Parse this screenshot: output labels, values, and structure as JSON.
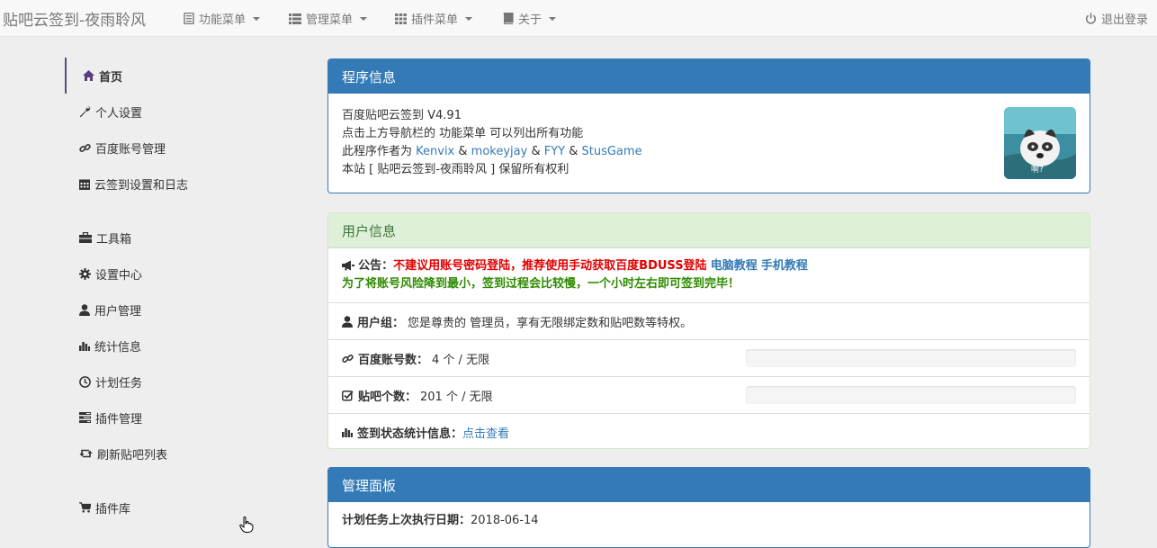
{
  "navbar": {
    "brand": "贴吧云签到-夜雨聆风",
    "menus": [
      {
        "label": "功能菜单",
        "icon": "list-icon"
      },
      {
        "label": "管理菜单",
        "icon": "th-list-icon"
      },
      {
        "label": "插件菜单",
        "icon": "th-icon"
      },
      {
        "label": "关于",
        "icon": "book-icon"
      }
    ],
    "logout": "退出登录"
  },
  "sidebar": {
    "items": [
      {
        "label": "首页",
        "icon": "home-icon",
        "active": true
      },
      {
        "label": "个人设置",
        "icon": "wrench-icon"
      },
      {
        "label": "百度账号管理",
        "icon": "link-icon"
      },
      {
        "label": "云签到设置和日志",
        "icon": "calendar-icon"
      },
      {
        "label": "工具箱",
        "icon": "briefcase-icon"
      },
      {
        "label": "设置中心",
        "icon": "cog-icon"
      },
      {
        "label": "用户管理",
        "icon": "user-icon"
      },
      {
        "label": "统计信息",
        "icon": "stats-icon"
      },
      {
        "label": "计划任务",
        "icon": "clock-icon"
      },
      {
        "label": "插件管理",
        "icon": "tasks-icon"
      },
      {
        "label": "刷新贴吧列表",
        "icon": "refresh-icon"
      },
      {
        "label": "插件库",
        "icon": "cart-icon"
      }
    ]
  },
  "program_info": {
    "title": "程序信息",
    "line1": "百度贴吧云签到 V4.91",
    "line2": "点击上方导航栏的 功能菜单 可以列出所有功能",
    "line3_prefix": "此程序作者为 ",
    "authors": [
      "Kenvix",
      "mokeyjay",
      "FYY",
      "StusGame"
    ],
    "amp": " & ",
    "line4": "本站 [ 贴吧云签到-夜雨聆风 ] 保留所有权利",
    "avatar_caption": "啊?"
  },
  "user_info": {
    "title": "用户信息",
    "notice_label": "公告：",
    "notice_red": "不建议用账号密码登陆，推荐使用手动获取百度BDUSS登陆",
    "notice_link1": "电脑教程",
    "notice_link2": "手机教程",
    "notice_green": "为了将账号风险降到最小，签到过程会比较慢，一个小时左右即可签到完毕！",
    "group_label": "用户组：",
    "group_value": "您是尊贵的 管理员，享有无限绑定数和贴吧数等特权。",
    "accounts_label": "百度账号数：",
    "accounts_value": "4 个 / 无限",
    "accounts_progress": 0,
    "tieba_label": "贴吧个数：",
    "tieba_value": "201 个 / 无限",
    "tieba_progress": 0,
    "stats_label": "签到状态统计信息：",
    "stats_link": "点击查看"
  },
  "admin_panel": {
    "title": "管理面板",
    "cron_label": "计划任务上次执行日期：",
    "cron_value": "2018-06-14"
  },
  "colors": {
    "primary": "#337ab7",
    "success_bg": "#dff0d8",
    "success_text": "#3c763d",
    "notice_red": "#e00000",
    "notice_green": "#2e8b00"
  }
}
